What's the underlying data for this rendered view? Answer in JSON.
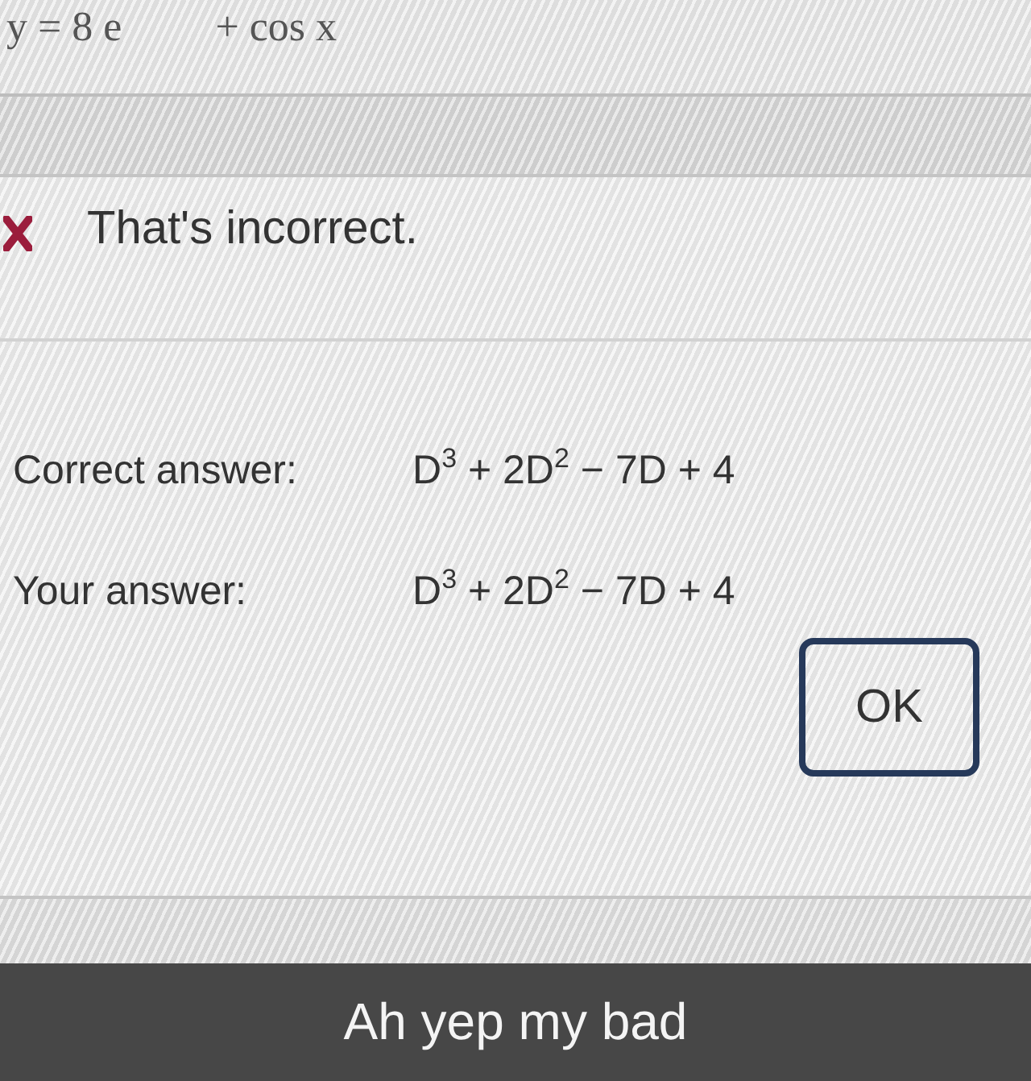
{
  "problem": {
    "equation_left": "y = 8 e",
    "equation_right": "+ cos x"
  },
  "feedback": {
    "kind": "incorrect",
    "message": "That's incorrect."
  },
  "answers": [
    {
      "label": "Correct answer:",
      "value": "D$^{3}$ + 2D$^{2}$ − 7D + 4"
    },
    {
      "label": "Your answer:",
      "value": "D$^{3}$ + 2D$^{2}$ − 7D + 4"
    }
  ],
  "buttons": [
    {
      "label": "OK",
      "focused": true
    }
  ],
  "caption": "Ah yep my bad"
}
